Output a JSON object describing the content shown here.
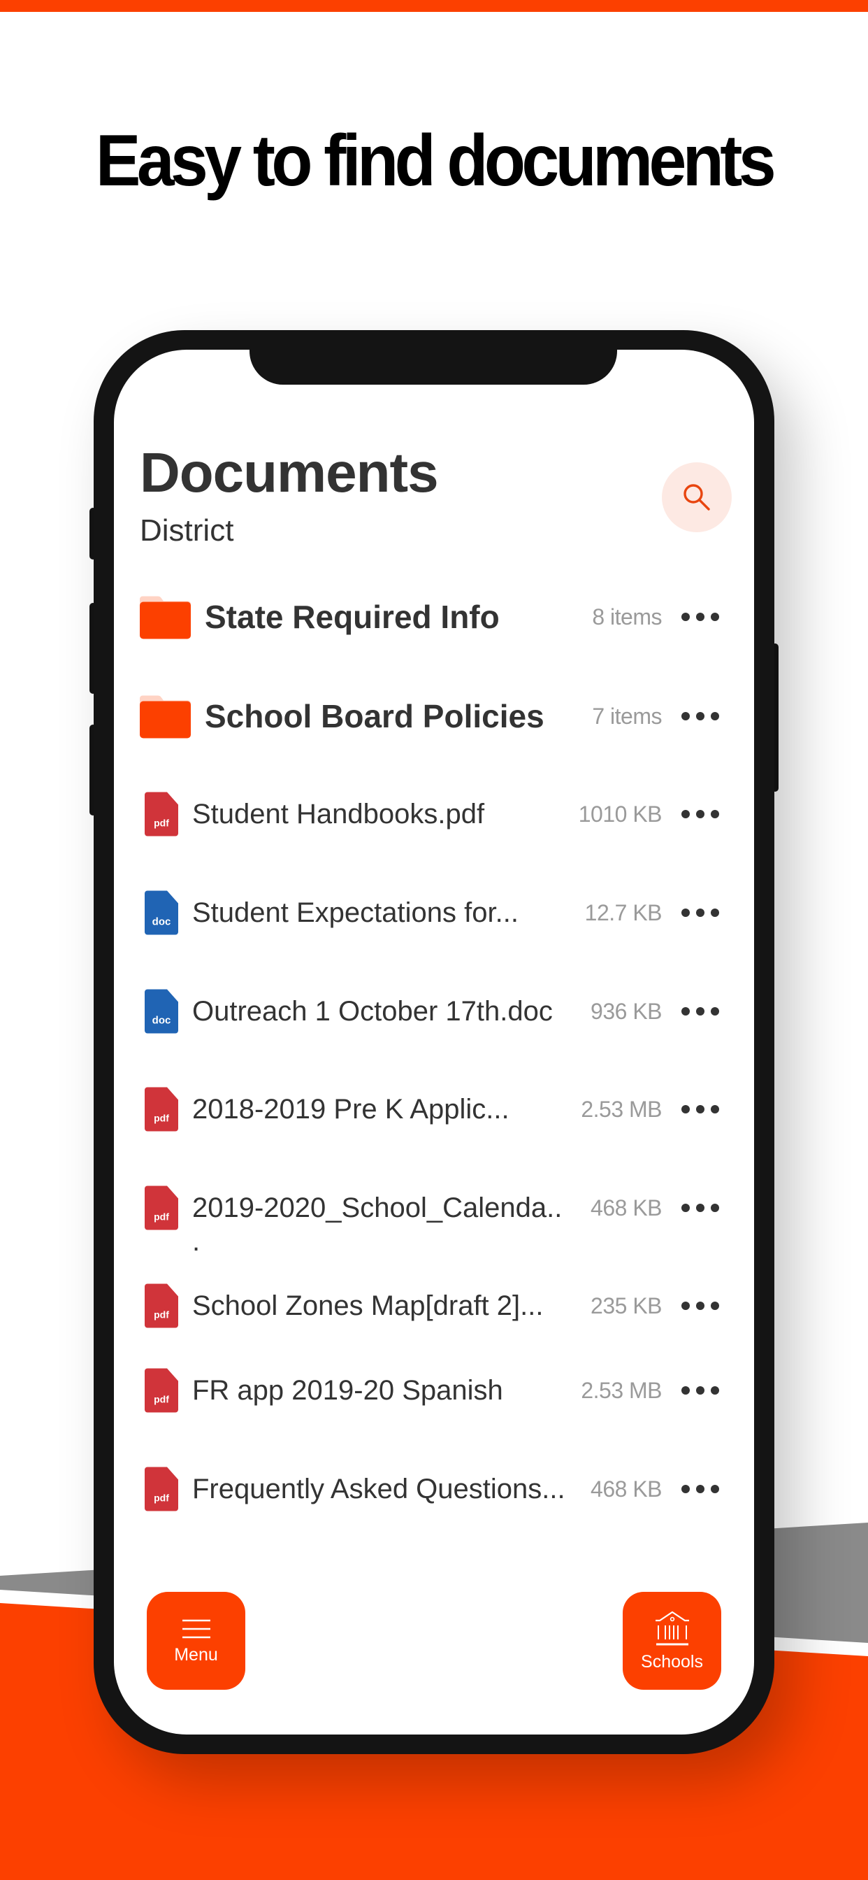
{
  "colors": {
    "brand_orange": "#FC4000",
    "dark_text": "#333333",
    "muted_text": "#9A9A9A",
    "pdf_red": "#D0343A",
    "doc_blue": "#2064B4",
    "folder_tab": "#FFD3C4",
    "search_bg": "#FDE9E3",
    "band_grey": "#8A8A8A",
    "phone_frame": "#141414"
  },
  "headline": "Easy to find documents",
  "screen": {
    "title": "Documents",
    "subtitle": "District",
    "search_icon": "search-icon",
    "folders": [
      {
        "name": "State Required Info",
        "meta": "8 items",
        "icon": "folder-icon"
      },
      {
        "name": "School Board Policies",
        "meta": "7 items",
        "icon": "folder-icon"
      }
    ],
    "files": [
      {
        "name": "Student Handbooks.pdf",
        "size": "1010 KB",
        "type": "pdf"
      },
      {
        "name": "Student Expectations for...",
        "size": "12.7 KB",
        "type": "doc"
      },
      {
        "name": "Outreach 1 October 17th.doc",
        "size": "936 KB",
        "type": "doc"
      },
      {
        "name": "2018-2019 Pre K Applic...",
        "size": "2.53 MB",
        "type": "pdf"
      },
      {
        "name": "2019-2020_School_Calenda..",
        "size": "468 KB",
        "type": "pdf",
        "wrap": "."
      },
      {
        "name": "School Zones Map[draft 2]...",
        "size": "235 KB",
        "type": "pdf"
      },
      {
        "name": "FR app 2019-20 Spanish",
        "size": "2.53 MB",
        "type": "pdf"
      },
      {
        "name": "Frequently Asked Questions...",
        "size": "468 KB",
        "type": "pdf"
      }
    ],
    "more_icon": "more-horizontal-icon",
    "bottom_nav": {
      "menu": {
        "label": "Menu",
        "icon": "hamburger-menu-icon"
      },
      "schools": {
        "label": "Schools",
        "icon": "school-building-icon"
      }
    }
  }
}
